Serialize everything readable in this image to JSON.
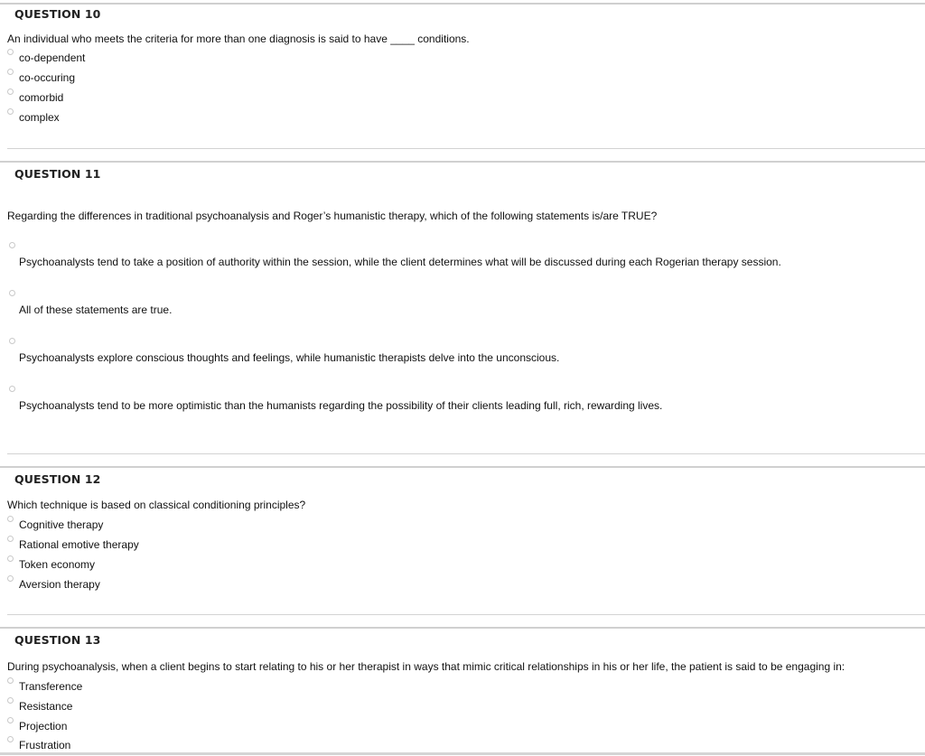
{
  "questions": [
    {
      "title": "QUESTION 10",
      "text": "An individual who meets the criteria for more than one diagnosis is said to have ____ conditions.",
      "options": [
        "co-dependent",
        "co-occuring",
        "comorbid",
        "complex"
      ]
    },
    {
      "title": "QUESTION 11",
      "text": "Regarding the differences in traditional psychoanalysis and Roger’s humanistic therapy, which of the following statements is/are TRUE?",
      "options": [
        "Psychoanalysts tend to take a position of authority within the session, while the client determines what will be discussed during each Rogerian therapy session.",
        "All of these statements are true.",
        "Psychoanalysts explore conscious thoughts and feelings, while humanistic therapists delve into the unconscious.",
        "Psychoanalysts tend to be more optimistic than the humanists regarding the possibility of their clients leading full, rich, rewarding lives."
      ]
    },
    {
      "title": "QUESTION 12",
      "text": "Which technique is based on classical conditioning principles?",
      "options": [
        "Cognitive therapy",
        "Rational emotive therapy",
        "Token economy",
        "Aversion therapy"
      ]
    },
    {
      "title": "QUESTION 13",
      "text": "During psychoanalysis, when a client begins to start relating to his or her therapist in ways that mimic critical relationships in his or her life, the patient is said to be engaging in:",
      "options": [
        "Transference",
        "Resistance",
        "Projection",
        "Frustration"
      ]
    }
  ]
}
